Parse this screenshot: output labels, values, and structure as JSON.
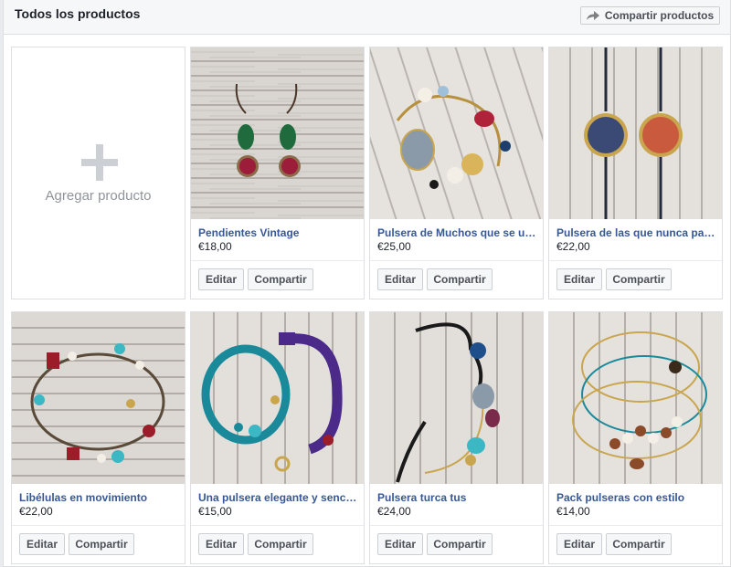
{
  "header": {
    "title": "Todos los productos",
    "share_button": "Compartir productos"
  },
  "add_product": {
    "label": "Agregar producto"
  },
  "products": [
    {
      "name": "Pendientes Vintage",
      "price": "€18,00"
    },
    {
      "name": "Pulsera de Muchos que se unen",
      "price": "€25,00"
    },
    {
      "name": "Pulsera de las que nunca pasan de moda",
      "price": "€22,00"
    },
    {
      "name": "Libélulas en movimiento",
      "price": "€22,00"
    },
    {
      "name": "Una pulsera elegante y sencilla",
      "price": "€15,00"
    },
    {
      "name": "Pulsera turca tus",
      "price": "€24,00"
    },
    {
      "name": "Pack pulseras con estilo",
      "price": "€14,00"
    }
  ],
  "actions": {
    "edit": "Editar",
    "share": "Compartir"
  },
  "icons": {
    "share": "share-arrow-icon",
    "add": "plus-icon"
  },
  "colors": {
    "link": "#365899",
    "border": "#dddfe2",
    "header_bg": "#f6f7f9"
  }
}
